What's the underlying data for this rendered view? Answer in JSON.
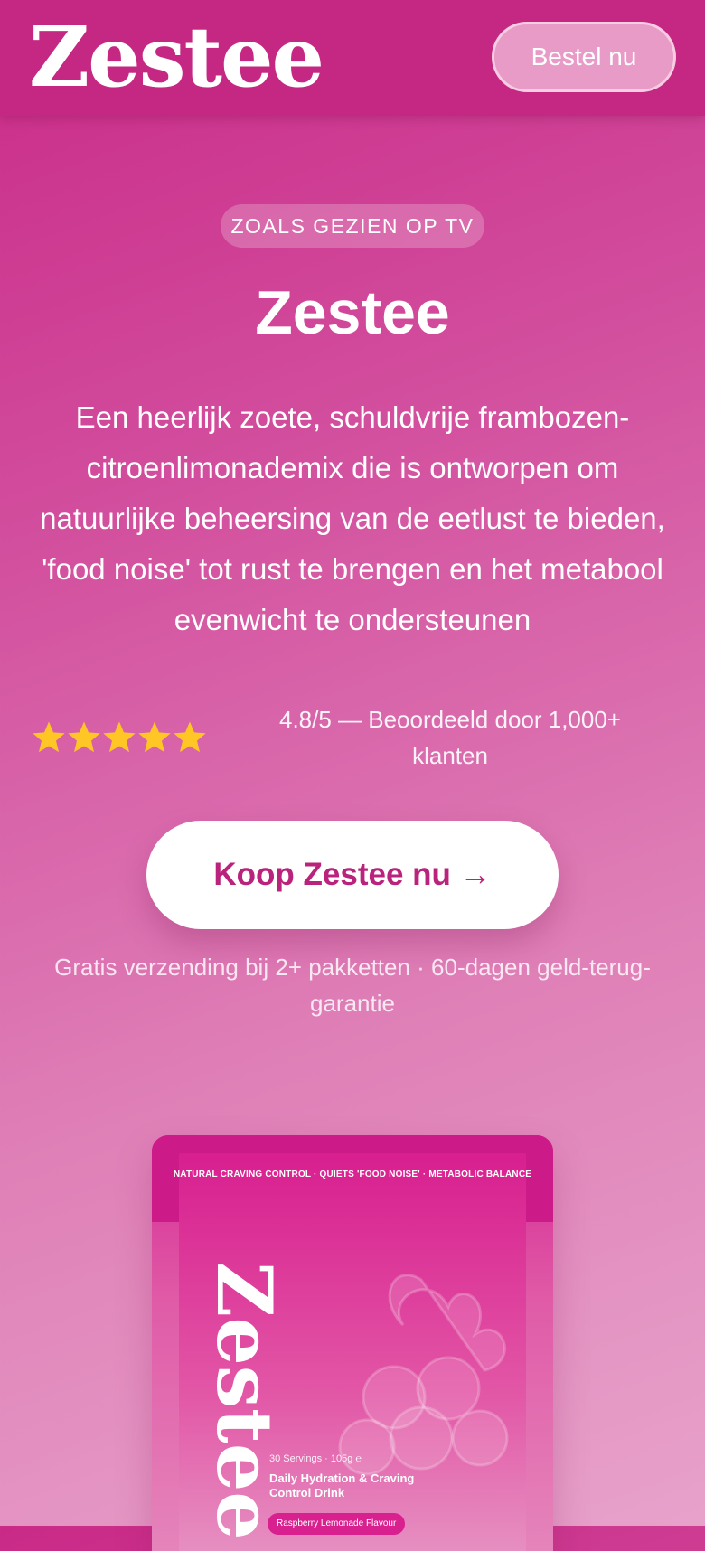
{
  "header": {
    "brand": "Zestee",
    "order_label": "Bestel nu"
  },
  "hero": {
    "badge": "ZOALS GEZIEN OP TV",
    "title": "Zestee",
    "description": "Een heerlijk zoete, schuldvrije frambozen-citroenlimonademix die is ontworpen om natuurlijke beheersing van de eetlust te bieden, 'food noise' tot rust te brengen en het metabool evenwicht te ondersteunen"
  },
  "rating": {
    "stars": 5,
    "text": "4.8/5 — Beoordeeld door 1,000+ klanten",
    "star_color": "#ffc626"
  },
  "cta": {
    "label": "Koop Zestee nu →",
    "note": "Gratis verzending bij 2+ pakketten · 60-dagen geld-terug-garantie"
  },
  "product": {
    "tagline": "NATURAL CRAVING CONTROL · QUIETS 'FOOD NOISE' · METABOLIC BALANCE",
    "brand": "Zestee",
    "servings": "30 Servings · 105g ℮",
    "name": "Daily Hydration & Craving Control Drink",
    "flavour": "Raspberry Lemonade Flavour"
  },
  "colors": {
    "brand_pink": "#c42883",
    "cta_text": "#b9237c"
  }
}
